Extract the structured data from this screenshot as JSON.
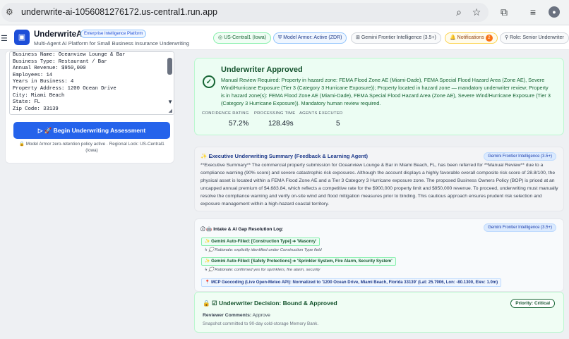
{
  "browser": {
    "url": "underwrite-ai-1056081276172.us-central1.run.app"
  },
  "app": {
    "name": "UnderwriteAI",
    "badge": "Enterprise Intelligence Platform",
    "subtitle": "Multi-Agent AI Platform for Small Business Insurance Underwriting",
    "region": "US-Central1 (Iowa)",
    "armor": "Model Armor: Active (ZDR)",
    "model": "Gemini Frontier Intelligence (3.5+)",
    "notifications": "Notifications",
    "notif_count": "2",
    "role": "Role: Senior Underwriter"
  },
  "form": {
    "lines": [
      "Business Name: Oceanview Lounge & Bar",
      "Business Type: Restaurant / Bar",
      "Annual Revenue: $950,000",
      "Employees: 14",
      "Years in Business: 4",
      "Property Address: 1200 Ocean Drive",
      "City: Miami Beach",
      "State: FL",
      "Zip Code: 33139"
    ],
    "button": "Begin Underwriting Assessment",
    "note": "Model Armor zero-retention policy active · Regional Lock: US-Central1 (Iowa)"
  },
  "result": {
    "title": "Underwriter Approved",
    "text": "Manual Review Required: Property in hazard zone: FEMA Flood Zone AE (Miami-Dade), FEMA Special Flood Hazard Area (Zone AE), Severe Wind/Hurricane Exposure (Tier 3 (Category 3 Hurricane Exposure)); Property located in hazard zone — mandatory underwriter review; Property is in hazard zone(s): FEMA Flood Zone AE (Miami-Dade), FEMA Special Flood Hazard Area (Zone AE), Severe Wind/Hurricane Exposure (Tier 3 (Category 3 Hurricane Exposure)). Mandatory human review required.",
    "metrics": [
      {
        "label": "CONFIDENCE RATING",
        "value": "57.2%"
      },
      {
        "label": "PROCESSING TIME",
        "value": "128.49s"
      },
      {
        "label": "AGENTS EXECUTED",
        "value": "5"
      }
    ]
  },
  "summary": {
    "title": "Executive Underwriting Summary (Feedback & Learning Agent)",
    "model": "Gemini Frontier Intelligence (3.5+)",
    "text": "**Executive Summary** The commercial property submission for Oceanview Lounge & Bar in Miami Beach, FL, has been referred for **Manual Review** due to a compliance warning (90% score) and severe catastrophic risk exposures. Although the account displays a highly favorable overall composite risk score of 28.8/100, the physical asset is located within a FEMA Flood Zone AE and a Tier 3 Category 3 Hurricane exposure zone. The proposed Business Owners Policy (BOP) is priced at an uncapped annual premium of $4,683.84, which reflects a competitive rate for the $900,000 property limit and $950,000 revenue. To proceed, underwriting must manually resolve the compliance warning and verify on-site wind and flood mitigation measures prior to binding. This cautious approach ensures prudent risk selection and exposure management within a high-hazard coastal territory."
  },
  "intake": {
    "title": "Intake & AI Gap Resolution Log:",
    "model": "Gemini Frontier Intelligence (3.5+)",
    "items": [
      {
        "fill": "Gemini Auto-Filled: [Construction Type] ➔ 'Masonry'",
        "rationale": "Rationale: explicitly identified under Construction Type field"
      },
      {
        "fill": "Gemini Auto-Filled: [Safety Protections] ➔ 'Sprinkler System, Fire Alarm, Security System'",
        "rationale": "Rationale: confirmed yes for sprinklers, fire alarm, security"
      }
    ],
    "mcp": "MCP Geocoding (Live Open-Meteo API): Normalized to '1200 Ocean Drive, Miami Beach, Florida 33139' (Lat: 25.7906, Lon: -80.1300, Elev: 1.0m)"
  },
  "decision": {
    "title": "Underwriter Decision: Bound & Approved",
    "priority": "Priority: Critical",
    "comments_label": "Reviewer Comments:",
    "comments": "Approve",
    "snapshot": "Snapshot committed to 90-day cold-storage Memory Bank."
  }
}
